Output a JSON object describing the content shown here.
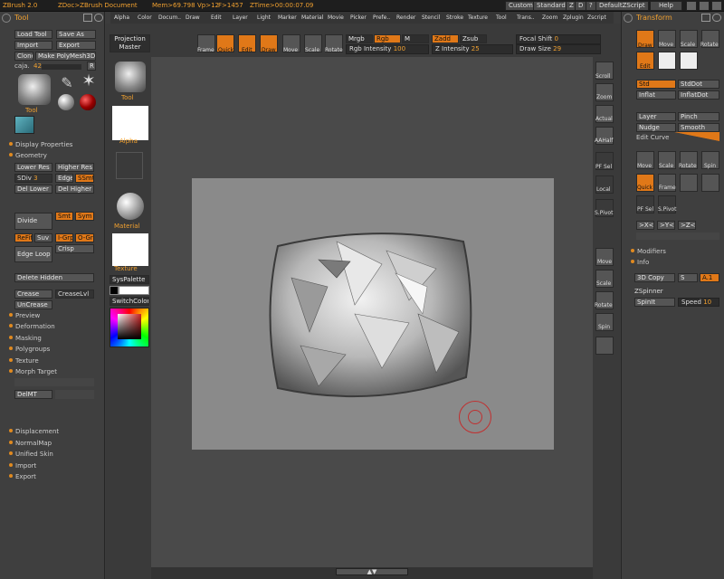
{
  "titlebar": {
    "app": "ZBrush 2.0",
    "doc": "ZDoc>ZBrush Document",
    "mem": "Mem>69.798",
    "vp": "Vp>12",
    "fp": "F>1457",
    "ztime": "ZTime>00:00:07.09",
    "custom": "Custom",
    "standard": "Standard",
    "z": "Z",
    "d": "D",
    "q": "?",
    "defaultzscript": "DefaultZScript",
    "help": "Help"
  },
  "menu": [
    "Alpha",
    "Color",
    "Docum..",
    "Draw",
    "Edit",
    "Layer",
    "Light",
    "Marker",
    "Material",
    "Movie",
    "Picker",
    "Prefe..",
    "Render",
    "Stencil",
    "Stroke",
    "Texture",
    "Tool",
    "Trans..",
    "Zoom",
    "Zplugin",
    "Zscript"
  ],
  "left": {
    "header": "Tool",
    "load": "Load Tool",
    "save_as": "Save As",
    "import": "Import",
    "export": "Export",
    "clone": "Clone",
    "make_poly": "Make PolyMesh3D",
    "tool_name": "caja.",
    "tool_num": "42",
    "r": "R",
    "tool_label": "Tool",
    "display_props": "Display Properties",
    "geometry": "Geometry",
    "lower_res": "Lower Res",
    "higher_res": "Higher Res",
    "sdiv": "SDiv",
    "sdiv_val": "3",
    "edge": "Edge",
    "ssmt": "SSmt",
    "del_lower": "Del Lower",
    "del_higher": "Del Higher",
    "divide": "Divide",
    "smt": "Smt",
    "sym": "Sym",
    "refit": "ReFit",
    "suv": "Suv",
    "igrp": "I-Grp",
    "ogrp": "O-Grp",
    "edge_loop": "Edge Loop",
    "crisp": "Crisp",
    "delete_hidden": "Delete Hidden",
    "crease": "Crease",
    "creaselvl": "CreaseLvl",
    "uncrease": "UnCrease",
    "sections": [
      "Preview",
      "Deformation",
      "Masking",
      "Polygroups",
      "Texture"
    ],
    "morph_target": "Morph Target",
    "delmt": "DelMT",
    "bottom_sections": [
      "Displacement",
      "NormalMap",
      "Unified Skin",
      "Import",
      "Export"
    ]
  },
  "toolshelf": {
    "projection": "Projection",
    "master": "Master",
    "tool": "Tool",
    "alpha": "Alpha",
    "material": "Material",
    "texture": "Texture",
    "syspalette": "SysPalette",
    "switchcolor": "SwitchColor"
  },
  "topshelf": {
    "frame": "Frame",
    "quick": "Quick",
    "edit": "Edit",
    "draw": "Draw",
    "move": "Move",
    "scale": "Scale",
    "rotate": "Rotate",
    "mrgb": "Mrgb",
    "rgb": "Rgb",
    "m": "M",
    "zadd": "Zadd",
    "zsub": "Zsub",
    "rgb_intensity_label": "Rgb Intensity",
    "rgb_intensity": "100",
    "z_intensity_label": "Z Intensity",
    "z_intensity": "25",
    "focal_label": "Focal Shift",
    "focal": "0",
    "draw_size_label": "Draw Size",
    "draw_size": "29"
  },
  "rightshelf": [
    "Scroll",
    "Zoom",
    "Actual",
    "AAHalf",
    "PF Sel",
    "Local",
    "S.Pivot",
    "Move",
    "Scale",
    "Rotate",
    "Spin"
  ],
  "right": {
    "header": "Transform",
    "draw": "Draw",
    "move": "Move",
    "scale": "Scale",
    "rotate": "Rotate",
    "edit": "Edit",
    "std": "Std",
    "stddot": "StdDot",
    "inflat": "Inflat",
    "inflatdot": "InflatDot",
    "layer": "Layer",
    "pinch": "Pinch",
    "nudge": "Nudge",
    "smooth": "Smooth",
    "edit_curve": "Edit Curve",
    "t_move": "Move",
    "t_scale": "Scale",
    "t_rotate": "Rotate",
    "t_spin": "Spin",
    "quick": "Quick",
    "frame": "Frame",
    "pfsel": "PF Sel",
    "spivot": "S.Pivot",
    "xx": ">X<",
    "yy": ">Y<",
    "zz": ">Z<",
    "modifiers": "Modifiers",
    "info": "Info",
    "copy3d": "3D Copy",
    "s": "S",
    "a1": "A.1",
    "zspinner": "ZSpinner",
    "spinit": "SpinIt",
    "speed_label": "Speed",
    "speed": "10"
  },
  "colors": {
    "accent": "#e07818",
    "panel": "#3f3f3f",
    "canvas": "#8a8a8a"
  }
}
